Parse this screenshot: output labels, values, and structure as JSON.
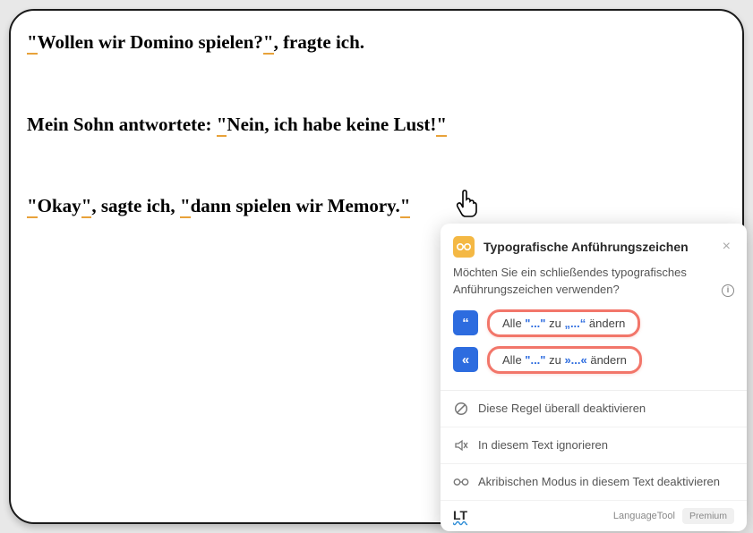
{
  "paragraphs": {
    "p1": {
      "seg1": "\"",
      "seg2": "Wollen wir Domino spielen?",
      "seg3": "\"",
      "seg4": ", fragte ich."
    },
    "p2": {
      "seg1": "Mein Sohn antwortete: ",
      "seg2": "\"",
      "seg3": "Nein, ich habe keine Lust!",
      "seg4": "\""
    },
    "p3": {
      "seg1": "\"",
      "seg2": "Okay",
      "seg3": "\"",
      "seg4": ", sagte ich, ",
      "seg5": "\"",
      "seg6": "dann spielen wir Memory.",
      "seg7": "\""
    }
  },
  "popup": {
    "title": "Typografische Anführungszeichen",
    "description": "Möchten Sie ein schließendes typografisches Anführungszeichen verwenden?",
    "suggestions": [
      {
        "badge": "“",
        "prefix": "Alle ",
        "q1": "\"...\"",
        "mid": " zu ",
        "q2": "„...“",
        "suffix": " ändern"
      },
      {
        "badge": "«",
        "prefix": "Alle ",
        "q1": "\"...\"",
        "mid": " zu ",
        "q2": "»...«",
        "suffix": " ändern"
      }
    ],
    "actions": {
      "deactivate_rule": "Diese Regel überall deaktivieren",
      "ignore_text": "In diesem Text ignorieren",
      "deactivate_picky": "Akribischen Modus in diesem Text deaktivieren"
    },
    "footer": {
      "logo": "LT",
      "link": "LanguageTool",
      "premium": "Premium"
    }
  }
}
